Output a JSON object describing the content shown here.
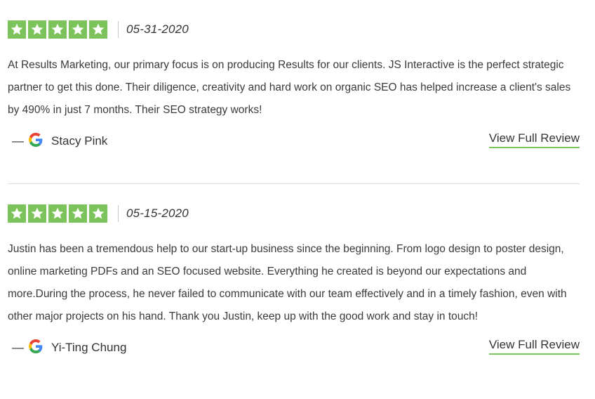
{
  "colors": {
    "star_bg": "#7dc35b",
    "link_underline": "#7dc35b",
    "text": "#333333",
    "divider": "#dddddd"
  },
  "reviews": [
    {
      "rating": 5,
      "date": "05-31-2020",
      "text": "At Results Marketing, our primary focus is on producing Results for our clients. JS Interactive is the perfect strategic partner to get this done. Their diligence, creativity and hard work on organic SEO has helped increase a client's sales by 490% in just 7 months. Their SEO strategy works!",
      "dash": "—",
      "source_icon": "google-icon",
      "author": "Stacy Pink",
      "link_label": "View Full Review"
    },
    {
      "rating": 5,
      "date": "05-15-2020",
      "text": "Justin has been a tremendous help to our start-up business since the beginning. From logo design to poster design, online marketing PDFs and an SEO focused website. Everything he created is beyond our expectations and more.During the process, he never failed to communicate with our team effectively and in a timely fashion, even with other major projects on his hand. Thank you Justin, keep up with the good work and stay in touch!",
      "dash": "—",
      "source_icon": "google-icon",
      "author": "Yi-Ting Chung",
      "link_label": "View Full Review"
    }
  ]
}
